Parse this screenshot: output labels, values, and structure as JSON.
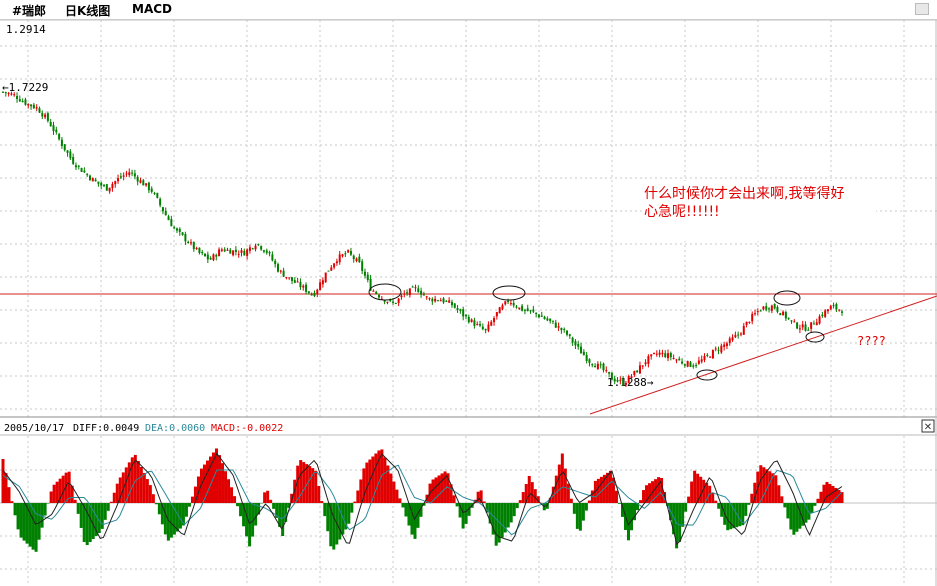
{
  "toolbar": {
    "security": "#瑞郎",
    "period": "日K线图",
    "indicator": "MACD"
  },
  "price_panel": {
    "top_value": "1.2914",
    "high_marker": "←1.7229",
    "low_marker": "1.1288→",
    "note_line1": "什么时候你才会出来啊,我等得好",
    "note_line2": "心急呢!!!!!!",
    "question": "????"
  },
  "macd_panel": {
    "date": "2005/10/17",
    "diff_label": "DIFF:0.0049",
    "dea_label": "DEA:0.0060",
    "macd_label": "MACD:-0.0022",
    "close_symbol": "✕"
  },
  "colors": {
    "up": "#e00000",
    "down": "#008000",
    "resistance": "#d02020",
    "dea": "#2a8a9a",
    "macd": "#e00000",
    "grid": "#c8c8c8"
  },
  "chart_data": [
    {
      "type": "candlestick",
      "title": "",
      "ylim": [
        1.1288,
        1.7229
      ],
      "close_path": [
        1.7229,
        1.716,
        1.7,
        1.69,
        1.662,
        1.621,
        1.583,
        1.56,
        1.54,
        1.526,
        1.545,
        1.56,
        1.54,
        1.52,
        1.478,
        1.44,
        1.42,
        1.395,
        1.38,
        1.402,
        1.398,
        1.395,
        1.415,
        1.396,
        1.358,
        1.34,
        1.325,
        1.308,
        1.35,
        1.382,
        1.395,
        1.372,
        1.322,
        1.302,
        1.29,
        1.312,
        1.322,
        1.3,
        1.3,
        1.29,
        1.268,
        1.25,
        1.234,
        1.272,
        1.298,
        1.28,
        1.274,
        1.262,
        1.248,
        1.23,
        1.2,
        1.174,
        1.16,
        1.138,
        1.1288,
        1.15,
        1.176,
        1.19,
        1.184,
        1.172,
        1.165,
        1.178,
        1.196,
        1.21,
        1.228,
        1.26,
        1.282,
        1.286,
        1.266,
        1.246,
        1.24,
        1.263,
        1.284,
        1.278
      ],
      "annotations": [
        "1.7229",
        "1.1288",
        "????"
      ]
    },
    {
      "type": "macd",
      "diff": 0.0049,
      "dea": 0.006,
      "macd": -0.0022,
      "histogram": [
        0.8,
        -0.6,
        -0.9,
        0.3,
        0.6,
        -0.8,
        -0.5,
        0.4,
        0.9,
        0.3,
        -0.7,
        -0.4,
        0.6,
        1.0,
        0.2,
        -0.8,
        0.3,
        -0.6,
        0.8,
        0.6,
        -0.9,
        -0.4,
        0.7,
        1.0,
        0.2,
        -0.7,
        0.4,
        0.6,
        -0.5,
        0.3,
        -0.8,
        -0.3,
        0.5,
        -0.2,
        0.9,
        -0.6,
        0.4,
        0.6,
        -0.7,
        0.3,
        0.5,
        -0.9,
        0.6,
        0.3,
        -0.5,
        -0.4,
        0.7,
        0.5,
        -0.6,
        -0.3,
        0.4,
        0.2
      ],
      "diff_line": [
        0.6,
        0.2,
        -0.4,
        -0.2,
        0.4,
        -0.1,
        -0.7,
        0.0,
        0.8,
        0.5,
        -0.3,
        -0.6,
        0.3,
        0.9,
        0.5,
        -0.4,
        0.0,
        -0.5,
        0.5,
        0.8,
        -0.2,
        -0.8,
        0.2,
        0.9,
        0.6,
        -0.3,
        0.2,
        0.5,
        -0.2,
        0.1,
        -0.6,
        -0.7,
        0.2,
        -0.1,
        0.6,
        0.0,
        0.2,
        0.6,
        -0.4,
        0.0,
        0.4,
        -0.8,
        -0.1,
        0.5,
        -0.3,
        -0.6,
        0.4,
        0.8,
        0.2,
        -0.6,
        0.1,
        0.3
      ],
      "dea_line": [
        0.5,
        0.3,
        -0.2,
        -0.3,
        0.1,
        0.1,
        -0.4,
        -0.3,
        0.4,
        0.6,
        0.1,
        -0.4,
        -0.1,
        0.6,
        0.6,
        0.0,
        -0.1,
        -0.3,
        0.1,
        0.6,
        0.2,
        -0.5,
        -0.3,
        0.5,
        0.7,
        0.1,
        0.0,
        0.3,
        0.1,
        0.0,
        -0.3,
        -0.6,
        -0.1,
        0.0,
        0.3,
        0.2,
        0.1,
        0.4,
        0.1,
        -0.1,
        0.2,
        -0.4,
        -0.4,
        0.2,
        0.1,
        -0.4,
        0.0,
        0.6,
        0.5,
        -0.2,
        -0.1,
        0.2
      ]
    }
  ]
}
